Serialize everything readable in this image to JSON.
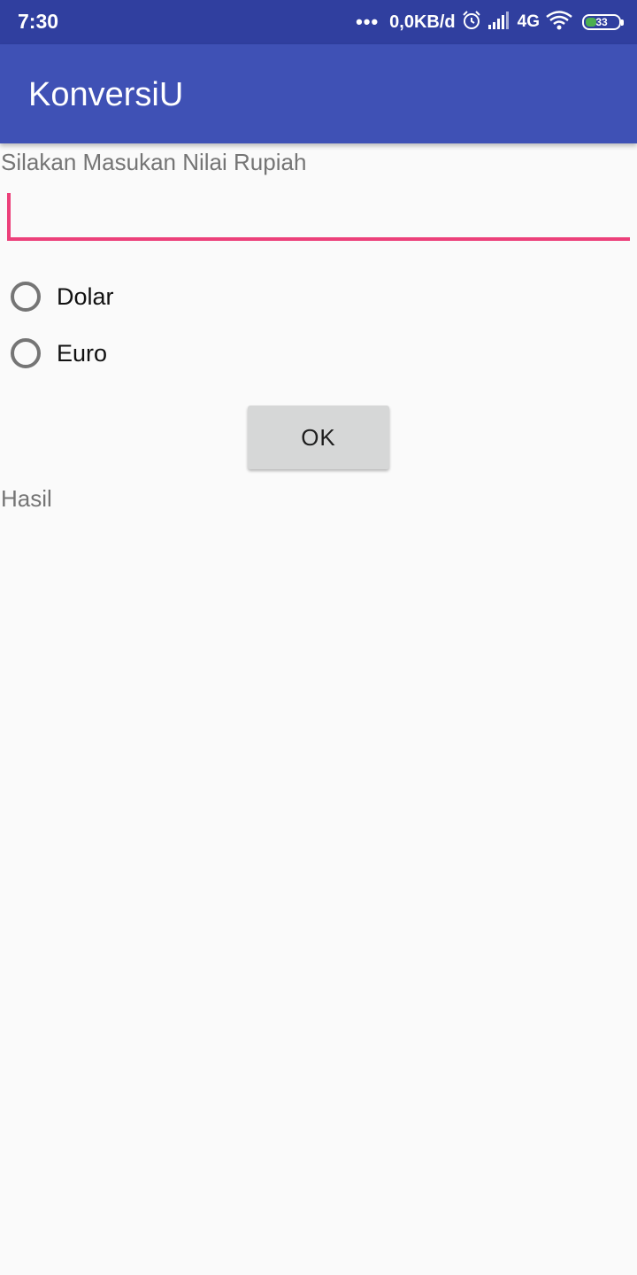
{
  "status_bar": {
    "time": "7:30",
    "dots": "•••",
    "net_speed": "0,0KB/d",
    "network": "4G",
    "battery": "33"
  },
  "app_bar": {
    "title": "KonversiU"
  },
  "form": {
    "prompt_label": "Silakan Masukan Nilai Rupiah",
    "input_value": "",
    "options": [
      {
        "label": "Dolar",
        "checked": false
      },
      {
        "label": "Euro",
        "checked": false
      }
    ],
    "ok_label": "OK",
    "result_label": "Hasil"
  },
  "colors": {
    "status_bar": "#303f9f",
    "app_bar": "#3f51b5",
    "accent": "#ec407a"
  }
}
